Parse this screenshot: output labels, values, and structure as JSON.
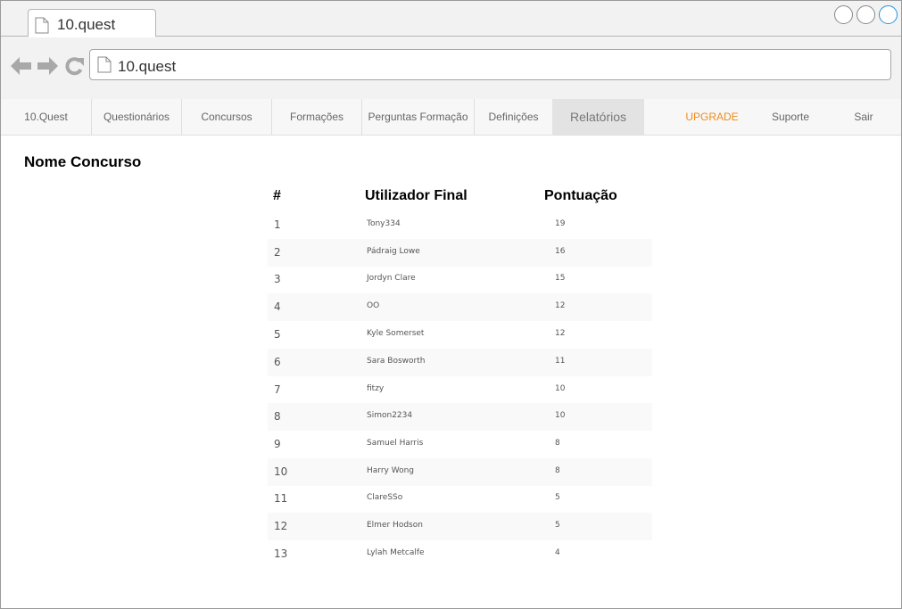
{
  "browser": {
    "tab_title": "10.quest",
    "address": "10.quest"
  },
  "nav": {
    "items": [
      {
        "label": "10.Quest"
      },
      {
        "label": "Questionários"
      },
      {
        "label": "Concursos"
      },
      {
        "label": "Formações"
      },
      {
        "label": "Perguntas Formação"
      },
      {
        "label": "Definições"
      },
      {
        "label": "Relatórios",
        "active": true
      },
      {
        "label": "UPGRADE"
      },
      {
        "label": "Suporte"
      },
      {
        "label": "Sair"
      }
    ],
    "upgrade_color": "#f08c1c"
  },
  "page": {
    "title": "Nome Concurso"
  },
  "table": {
    "headers": {
      "rank": "#",
      "user": "Utilizador Final",
      "score": "Pontuação"
    },
    "rows": [
      {
        "rank": "1",
        "user": "Tony334",
        "score": "19"
      },
      {
        "rank": "2",
        "user": "Pádraig Lowe",
        "score": "16"
      },
      {
        "rank": "3",
        "user": "Jordyn Clare",
        "score": "15"
      },
      {
        "rank": "4",
        "user": "OO",
        "score": "12"
      },
      {
        "rank": "5",
        "user": "Kyle Somerset",
        "score": "12"
      },
      {
        "rank": "6",
        "user": "Sara Bosworth",
        "score": "11"
      },
      {
        "rank": "7",
        "user": "fitzy",
        "score": "10"
      },
      {
        "rank": "8",
        "user": "Simon2234",
        "score": "10"
      },
      {
        "rank": "9",
        "user": "Samuel Harris",
        "score": "8"
      },
      {
        "rank": "10",
        "user": "Harry Wong",
        "score": "8"
      },
      {
        "rank": "11",
        "user": "ClareSSo",
        "score": "5"
      },
      {
        "rank": "12",
        "user": "Elmer Hodson",
        "score": "5"
      },
      {
        "rank": "13",
        "user": "Lylah Metcalfe",
        "score": "4"
      }
    ]
  }
}
